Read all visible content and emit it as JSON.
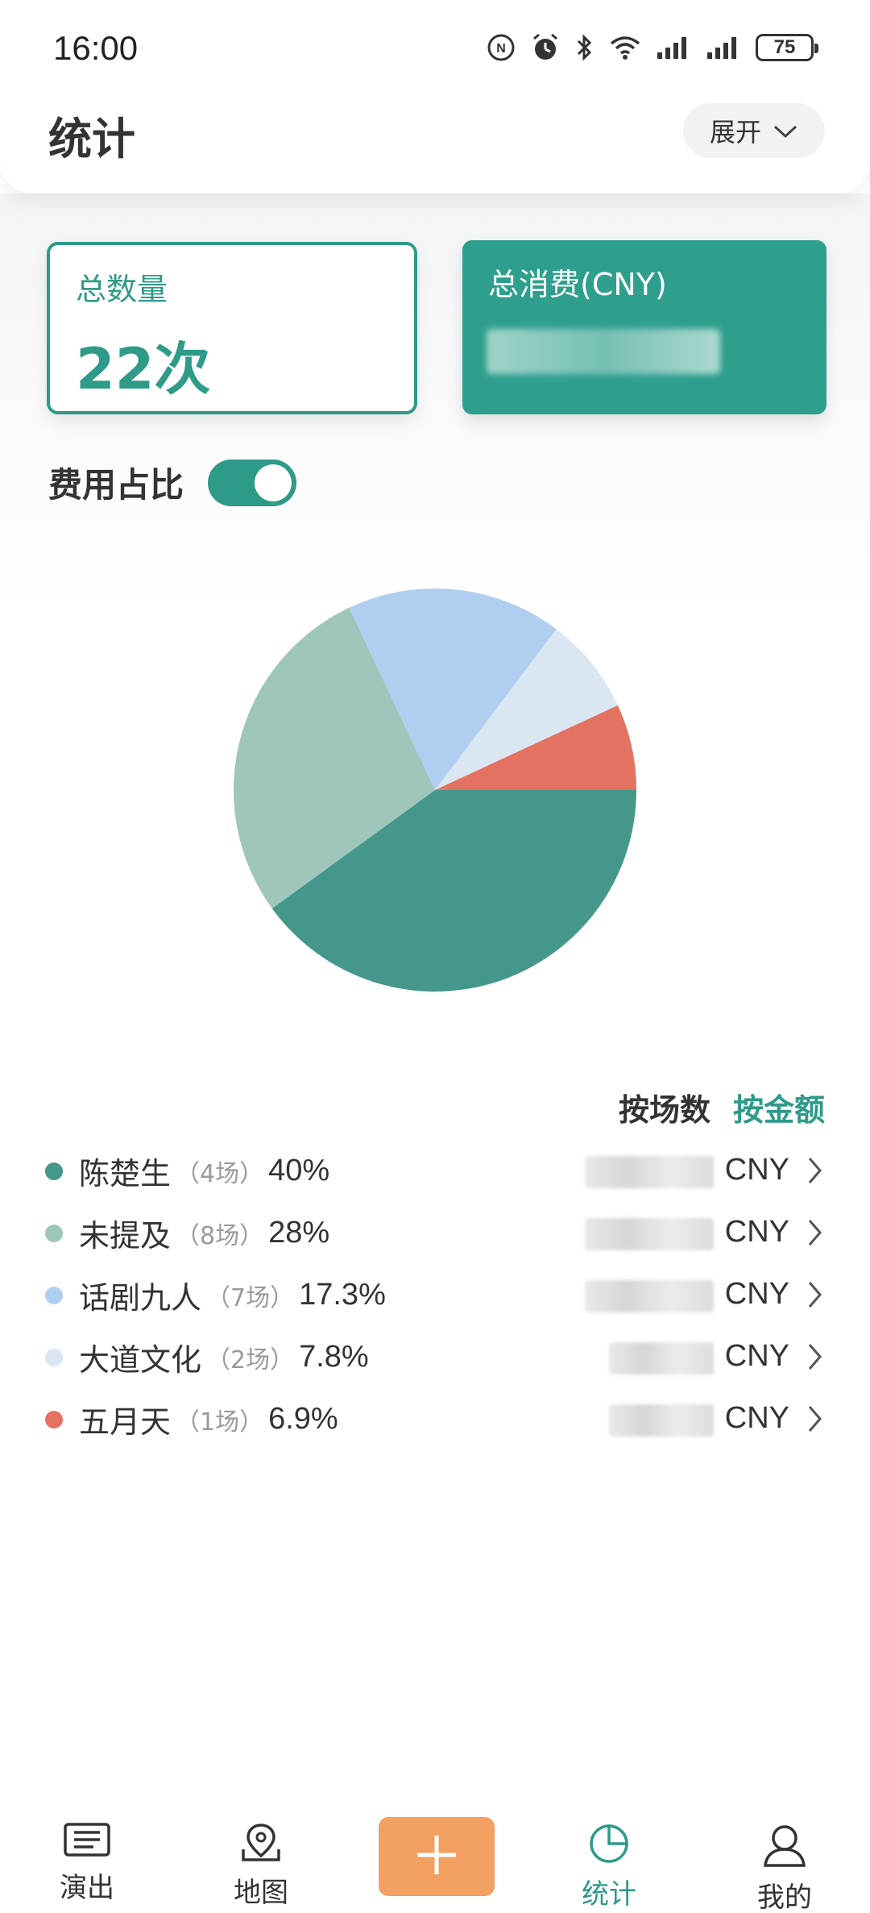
{
  "status_bar": {
    "time": "16:00",
    "battery": "75",
    "icons": [
      "nfc-icon",
      "alarm-icon",
      "bluetooth-icon",
      "wifi-icon",
      "signal-icon",
      "signal-icon",
      "battery-icon"
    ]
  },
  "header": {
    "title": "统计",
    "expand_label": "展开",
    "expand_icon": "chevron-down-icon"
  },
  "summary": {
    "count_label": "总数量",
    "count_value": "22次",
    "cost_label": "总消费(CNY)",
    "cost_value_hidden": true
  },
  "ratio": {
    "label": "费用占比",
    "toggle_on": true
  },
  "chart_data": {
    "type": "pie",
    "slices": [
      {
        "name": "陈楚生",
        "value": 40,
        "color": "#45978b"
      },
      {
        "name": "未提及",
        "value": 28,
        "color": "#9fc6bb"
      },
      {
        "name": "话剧九人",
        "value": 17.3,
        "color": "#b0cff0"
      },
      {
        "name": "大道文化",
        "value": 7.8,
        "color": "#dbe6f3"
      },
      {
        "name": "五月天",
        "value": 6.9,
        "color": "#e47261"
      }
    ]
  },
  "sort_tabs": {
    "by_count": "按场数",
    "by_amount": "按金额",
    "active": "by_amount"
  },
  "legend": [
    {
      "name": "陈楚生",
      "count": "（4场）",
      "pct": "40%",
      "currency": "CNY",
      "color": "#45978b"
    },
    {
      "name": "未提及",
      "count": "（8场）",
      "pct": "28%",
      "currency": "CNY",
      "color": "#9fc6bb"
    },
    {
      "name": "话剧九人",
      "count": "（7场）",
      "pct": "17.3%",
      "currency": "CNY",
      "color": "#b0cff0"
    },
    {
      "name": "大道文化",
      "count": "（2场）",
      "pct": "7.8%",
      "currency": "CNY",
      "color": "#dbe6f3"
    },
    {
      "name": "五月天",
      "count": "（1场）",
      "pct": "6.9%",
      "currency": "CNY",
      "color": "#e47261"
    }
  ],
  "bottom_nav": {
    "shows": "演出",
    "map": "地图",
    "add_icon": "plus-icon",
    "stats": "统计",
    "mine": "我的",
    "active": "stats"
  },
  "colors": {
    "accent": "#2e9a88",
    "add_button": "#f3a063"
  }
}
